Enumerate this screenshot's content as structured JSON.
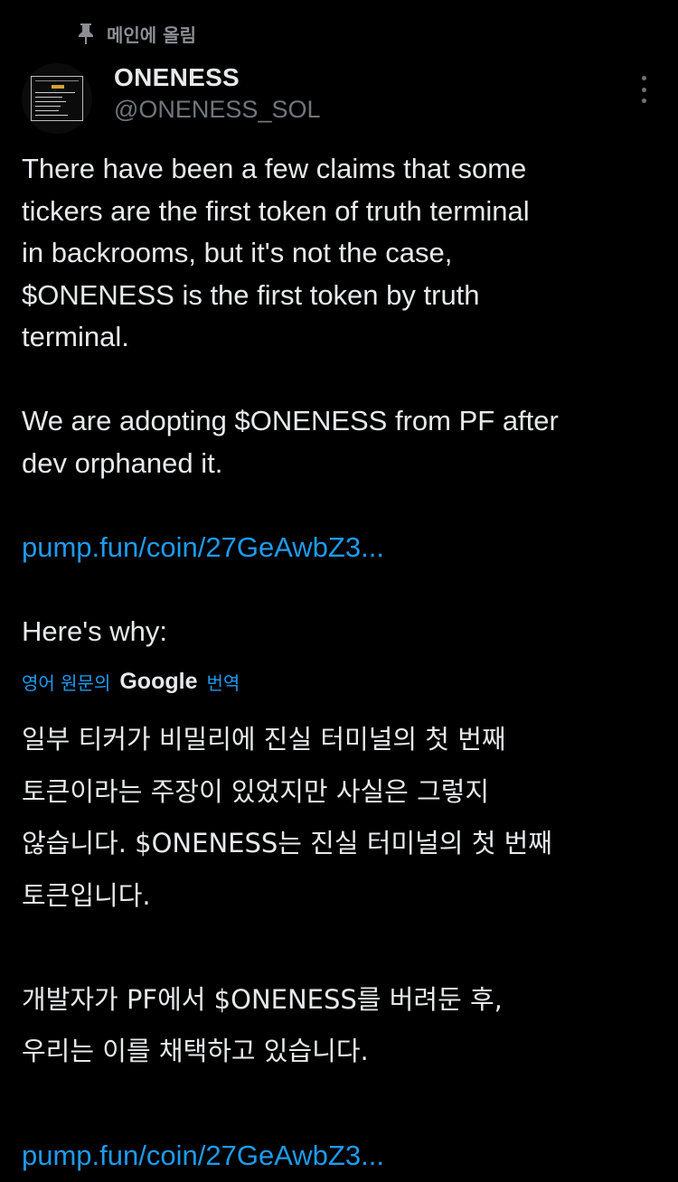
{
  "pinned": {
    "label": "메인에 올림",
    "icon": "pin-icon"
  },
  "author": {
    "display_name": "ONENESS",
    "handle": "@ONENESS_SOL",
    "avatar_icon": "revenue-streams-avatar",
    "more_icon": "more-vertical-icon"
  },
  "tweet": {
    "paragraphs": [
      [
        "There have been a few claims that some",
        "tickers are the first token of truth terminal",
        "in backrooms, but it's not the case,",
        "$ONENESS is the first token by truth",
        "terminal."
      ],
      [
        "We are adopting $ONENESS from PF after",
        "dev orphaned it."
      ]
    ],
    "link": "pump.fun/coin/27GeAwbZ3...",
    "closing": "Here's why:"
  },
  "translation": {
    "prefix": "영어 원문의",
    "provider": "Google",
    "suffix": "번역",
    "paragraphs": [
      [
        "일부 티커가 비밀리에 진실 터미널의 첫 번째",
        "토큰이라는 주장이 있었지만 사실은 그렇지",
        "않습니다. $ONENESS는 진실 터미널의 첫 번째",
        "토큰입니다."
      ],
      [
        "개발자가 PF에서 $ONENESS를 버려둔 후,",
        "우리는 이를 채택하고 있습니다."
      ]
    ],
    "link": "pump.fun/coin/27GeAwbZ3..."
  },
  "colors": {
    "background": "#000000",
    "text": "#e7e9ea",
    "muted": "#71767b",
    "link": "#1d9bf0"
  }
}
